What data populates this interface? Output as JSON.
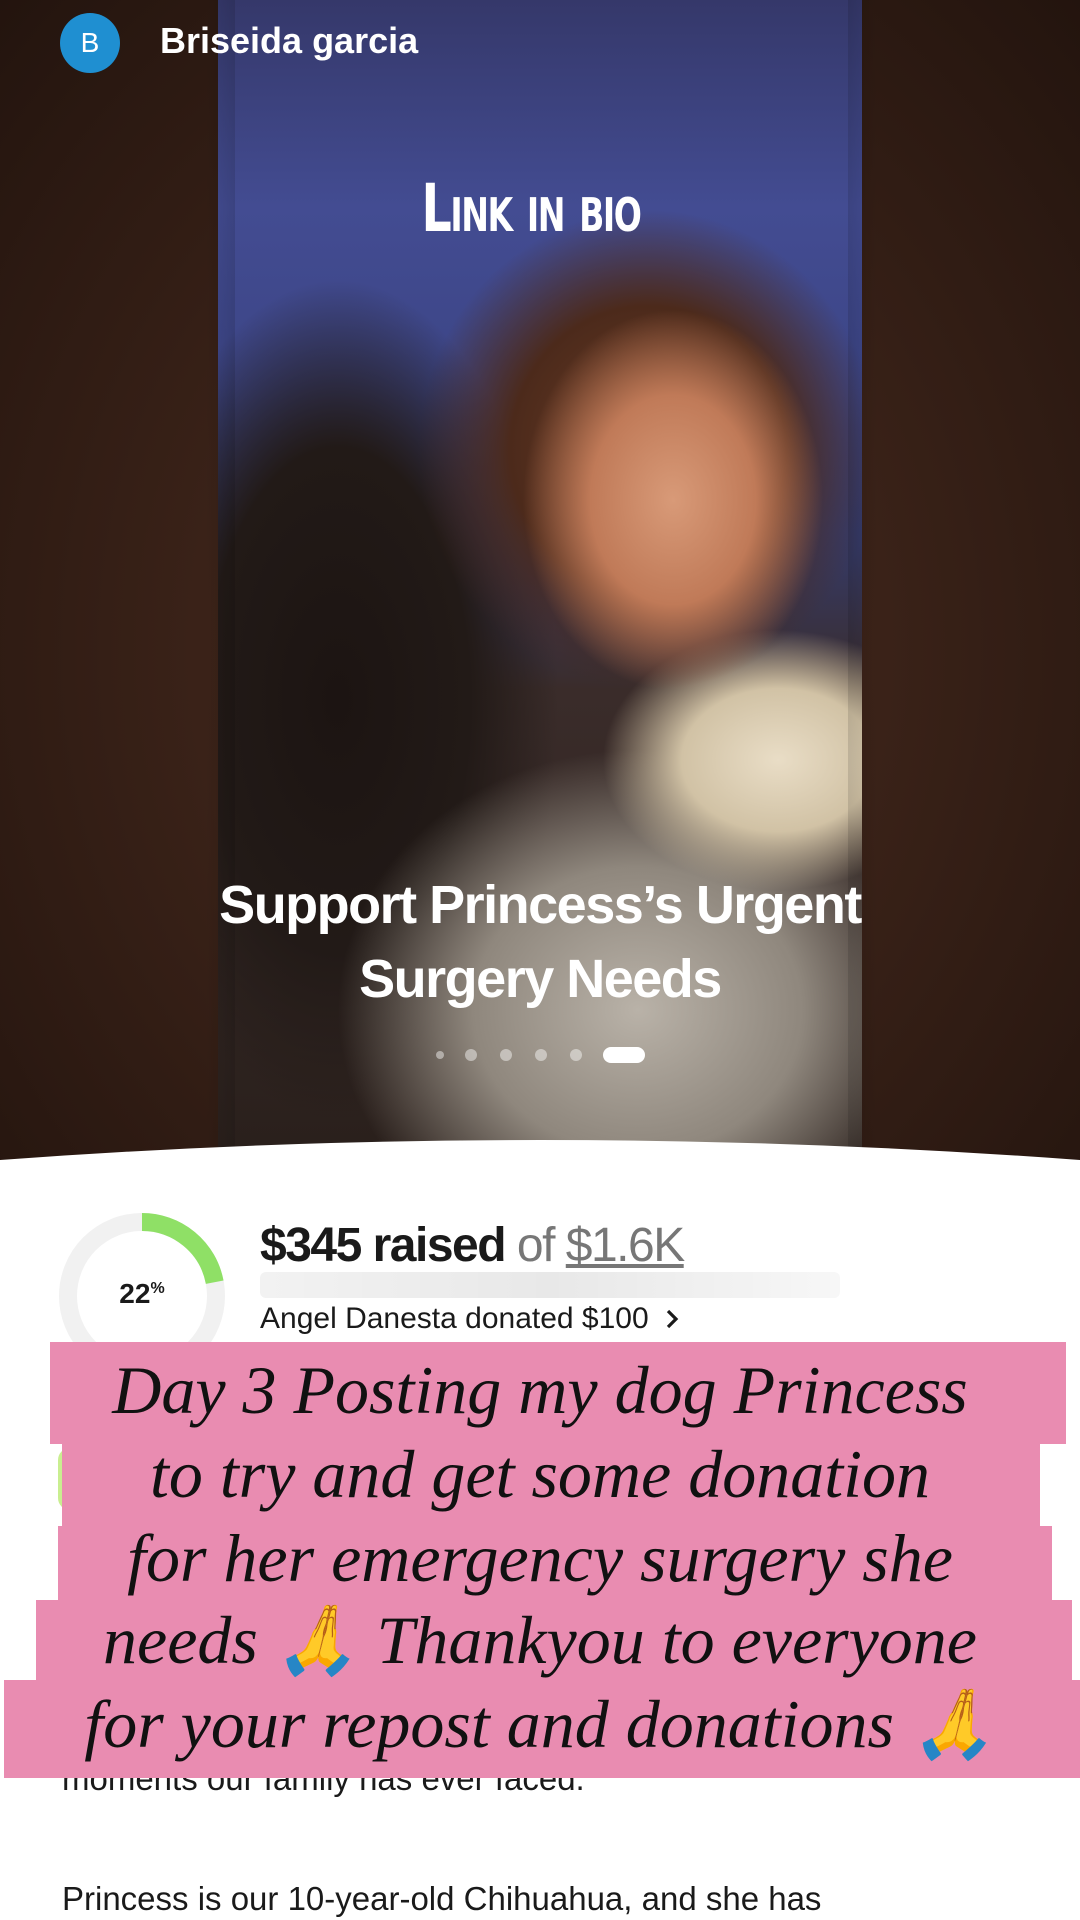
{
  "header": {
    "avatar_letter": "B",
    "user_name": "Briseida garcia",
    "avatar_color": "#1f8fd1"
  },
  "hero": {
    "overlay_text": "Link in bio",
    "campaign_title": "Support Princess’s Urgent Surgery Needs",
    "carousel": {
      "slides": 6,
      "active_index": 5
    }
  },
  "fundraiser": {
    "progress_percent": "22",
    "progress_suffix": "%",
    "progress_fraction": 0.22,
    "raised_amount": "$345 raised",
    "of_label": "of",
    "goal_amount": "$1.6K",
    "recent_donation": "Angel Danesta donated $100",
    "progress_color": "#8fe066"
  },
  "story": {
    "para_1_partial": "moments our family has ever faced.",
    "para_2_partial": "Princess is our 10-year-old Chihuahua, and she has"
  },
  "caption": {
    "lines": [
      "Day 3 Posting my dog Princess",
      "to try and get some donation",
      "for her emergency surgery she",
      "needs 🙏 Thankyou to everyone",
      "for your repost and donations  🙏"
    ],
    "band_color": "#e98cb1"
  },
  "icons": {
    "chevron": "chevron-right-icon"
  }
}
